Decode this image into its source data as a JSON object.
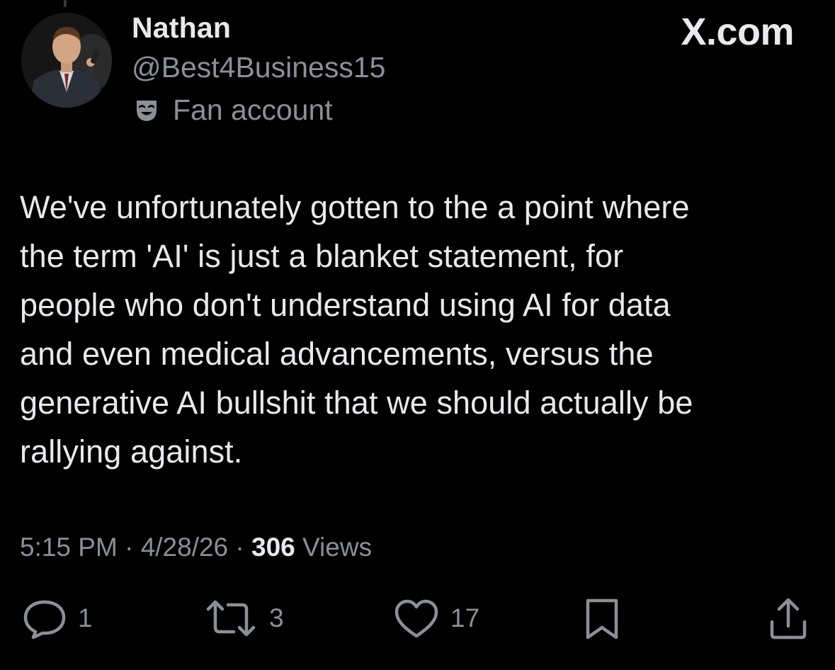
{
  "user": {
    "display_name": "Nathan",
    "handle": "@Best4Business15",
    "badge_label": "Fan account",
    "avatar_icon": "profile-photo"
  },
  "brand": "X.com",
  "tweet": {
    "text": "We've unfortunately gotten to the a point where\nthe term 'AI' is just a blanket statement, for\npeople who don't understand using AI for data\nand even medical advancements, versus the\ngenerative AI bullshit that we should actually be\nrallying against."
  },
  "meta": {
    "time": "5:15 PM",
    "date": "4/28/26",
    "separator": "·",
    "views_count": "306",
    "views_label": "Views"
  },
  "actions": {
    "reply_count": "1",
    "retweet_count": "3",
    "like_count": "17"
  },
  "colors": {
    "background": "#000000",
    "text_primary": "#e7e9ea",
    "text_secondary": "#8b9096"
  }
}
